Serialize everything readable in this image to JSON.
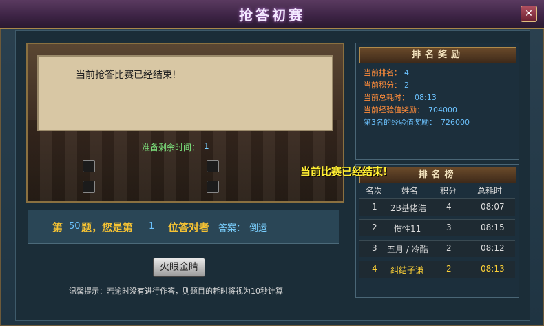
{
  "window": {
    "title": "抢答初赛",
    "close_label": "✕"
  },
  "stage": {
    "question": "当前抢答比赛已经结束!",
    "timer_label": "准备剩余时间：",
    "timer_value": "1"
  },
  "result": {
    "di": "第",
    "question_no": "50",
    "mid": "题，您是第",
    "rank": "1",
    "end": "位答对者",
    "answer_label": "答案：",
    "answer": "倒运"
  },
  "skill_button": "火眼金睛",
  "tip": "温馨提示：若逾时没有进行作答，则题目的耗时将视为10秒计算",
  "reward": {
    "header": "排名奖励",
    "rows": [
      {
        "label": "当前排名：",
        "value": "4"
      },
      {
        "label": "当前积分：",
        "value": "2"
      },
      {
        "label": "当前总耗时：",
        "value": "08:13"
      },
      {
        "label": "当前经验值奖励：",
        "value": "704000"
      },
      {
        "label": "第3名的经验值奖励：",
        "value": "726000"
      }
    ]
  },
  "announce": "当前比赛已经结束!",
  "leaderboard": {
    "header": "排名榜",
    "columns": [
      "名次",
      "姓名",
      "积分",
      "总耗时"
    ],
    "rows": [
      {
        "rank": "1",
        "name": "2B基佬浩",
        "score": "4",
        "time": "08:07"
      },
      {
        "rank": "2",
        "name": "惯性11",
        "score": "3",
        "time": "08:15"
      },
      {
        "rank": "3",
        "name": "五月 / 冷酷",
        "score": "2",
        "time": "08:12"
      },
      {
        "rank": "4",
        "name": "纠结子谦",
        "score": "2",
        "time": "08:13"
      }
    ]
  },
  "colors": {
    "accent_orange": "#ff8c3a",
    "value_blue": "#6cc3ff",
    "highlight_yellow": "#ffd236"
  }
}
